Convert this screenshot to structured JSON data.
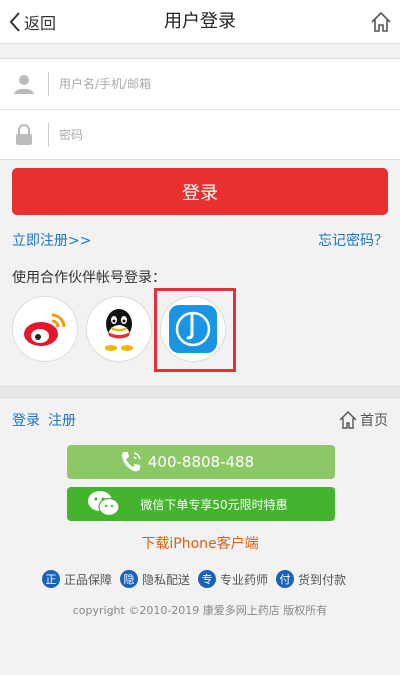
{
  "header": {
    "back_label": "返回",
    "title": "用户登录"
  },
  "form": {
    "username_placeholder": "用户名/手机/邮箱",
    "password_placeholder": "密码"
  },
  "login_label": "登录",
  "links": {
    "register": "立即注册>>",
    "forgot": "忘记密码？"
  },
  "partner_title": "使用合作伙伴帐号登录：",
  "partners": [
    "weibo-icon",
    "qq-icon",
    "app-store-login-icon"
  ],
  "footer_nav": {
    "login": "登录",
    "register": "注册",
    "home": "首页"
  },
  "phone": "400-8808-488",
  "wechat_promo": "微信下单专享50元限时特惠",
  "download": "下载iPhone客户端",
  "badges": [
    {
      "mark": "正",
      "label": "正品保障"
    },
    {
      "mark": "隐",
      "label": "隐私配送"
    },
    {
      "mark": "专",
      "label": "专业药师"
    },
    {
      "mark": "付",
      "label": "货到付款"
    }
  ],
  "copyright": "copyright ©2010-2019 康爱多网上药店 版权所有",
  "colors": {
    "primary_red": "#e8302e",
    "link_blue": "#1a75c9",
    "phone_green": "#8cc866",
    "wechat_green": "#44b32e",
    "download_orange": "#e05f12"
  }
}
